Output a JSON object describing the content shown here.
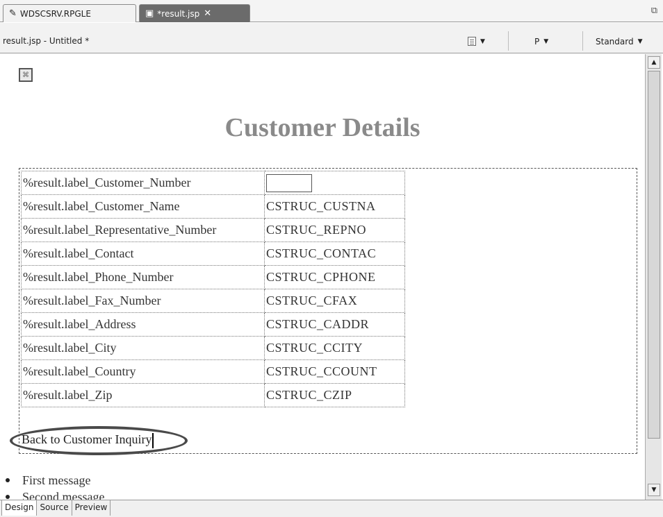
{
  "tabs": [
    {
      "label": "WDSCSRV.RPGLE",
      "icon": "pencil-icon"
    },
    {
      "label": "*result.jsp",
      "icon": "jsp-file-icon",
      "close": "✕"
    }
  ],
  "toolbar": {
    "title": "result.jsp - Untitled *",
    "paragraph": "P",
    "mode": "Standard",
    "arrow": "▼"
  },
  "page": {
    "heading": "Customer Details",
    "fields": [
      {
        "label": "%result.label_Customer_Number",
        "value": ""
      },
      {
        "label": "%result.label_Customer_Name",
        "value": "CSTRUC_CUSTNA"
      },
      {
        "label": "%result.label_Representative_Number",
        "value": "CSTRUC_REPNO"
      },
      {
        "label": "%result.label_Contact",
        "value": "CSTRUC_CONTAC"
      },
      {
        "label": "%result.label_Phone_Number",
        "value": "CSTRUC_CPHONE"
      },
      {
        "label": "%result.label_Fax_Number",
        "value": "CSTRUC_CFAX"
      },
      {
        "label": "%result.label_Address",
        "value": "CSTRUC_CADDR"
      },
      {
        "label": "%result.label_City",
        "value": "CSTRUC_CCITY"
      },
      {
        "label": "%result.label_Country",
        "value": "CSTRUC_CCOUNT"
      },
      {
        "label": "%result.label_Zip",
        "value": "CSTRUC_CZIP"
      }
    ],
    "back_link": "Back to Customer Inquiry",
    "messages": [
      "First message",
      "Second message"
    ]
  },
  "bottom_tabs": [
    "Design",
    "Source",
    "Preview"
  ]
}
